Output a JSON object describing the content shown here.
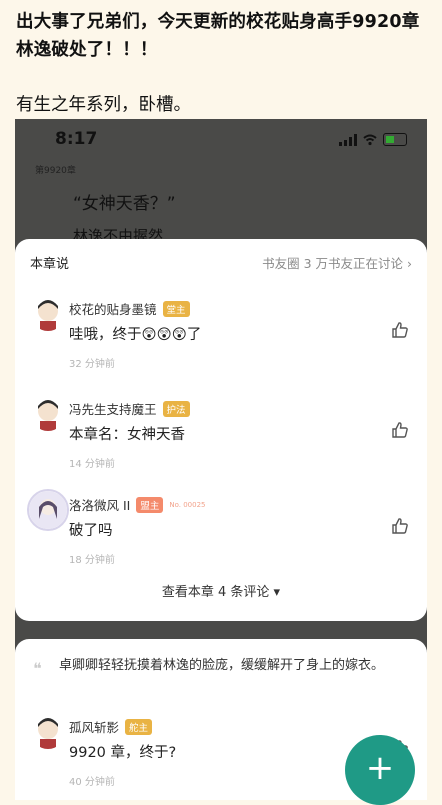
{
  "post": {
    "title": "出大事了兄弟们，今天更新的校花贴身高手9920章林逸破处了！！！",
    "subtitle": "有生之年系列，卧槽。"
  },
  "screenshot": {
    "status_time": "8:17",
    "chapter_tag": "第9920章",
    "reader_line_1": "“女神天香？”",
    "reader_line_2": "林逸不由握然",
    "comments_panel": {
      "title": "本章说",
      "circle_link": "书友圈 3 万书友正在讨论 ›",
      "comments": [
        {
          "user": "校花的贴身墨镜",
          "badge": "堂主",
          "text": "哇哦，终于😲😲😲了",
          "time": "32 分钟前"
        },
        {
          "user": "冯先生支持魔王",
          "badge": "护法",
          "text": "本章名：女神天香",
          "time": "14 分钟前"
        },
        {
          "user": "洛洛微风 II",
          "badge": "盟主",
          "badge_no": "No. 00025",
          "text": "破了吗",
          "time": "18 分钟前"
        }
      ],
      "more_label": "查看本章 4 条评论 ▾"
    },
    "quote_card": {
      "quote": "卓卿卿轻轻抚摸着林逸的脸庞，缓缓解开了身上的嫁衣。",
      "comment": {
        "user": "孤风斩影",
        "badge": "舵主",
        "text": "9920 章，终于?",
        "time": "40 分钟前"
      }
    },
    "fab_label": "+"
  },
  "icons": {
    "like": "thumbs-up-icon",
    "quote": "quote-icon",
    "signal": "signal-icon",
    "wifi": "wifi-icon",
    "battery": "battery-icon"
  }
}
